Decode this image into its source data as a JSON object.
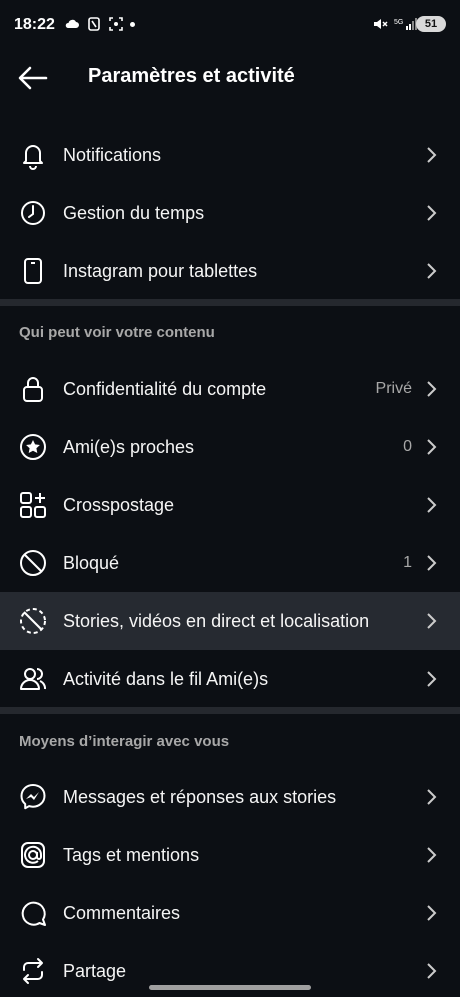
{
  "status_bar": {
    "time": "18:22",
    "battery": "51",
    "network": "5G"
  },
  "header": {
    "title": "Paramètres et activité"
  },
  "group1": [
    {
      "label": "Notifications",
      "value": "",
      "icon": "bell-icon"
    },
    {
      "label": "Gestion du temps",
      "value": "",
      "icon": "clock-icon"
    },
    {
      "label": "Instagram pour tablettes",
      "value": "",
      "icon": "tablet-icon"
    }
  ],
  "section_who": {
    "title": "Qui peut voir votre contenu",
    "items": [
      {
        "label": "Confidentialité du compte",
        "value": "Privé",
        "icon": "lock-icon"
      },
      {
        "label": "Ami(e)s proches",
        "value": "0",
        "icon": "star-circle-icon"
      },
      {
        "label": "Crosspostage",
        "value": "",
        "icon": "grid-plus-icon"
      },
      {
        "label": "Bloqué",
        "value": "1",
        "icon": "block-icon"
      },
      {
        "label": "Stories, vidéos en direct et localisation",
        "value": "",
        "icon": "story-off-icon"
      },
      {
        "label": "Activité dans le fil Ami(e)s",
        "value": "",
        "icon": "people-icon"
      }
    ]
  },
  "section_interact": {
    "title": "Moyens d’interagir avec vous",
    "items": [
      {
        "label": "Messages et réponses aux stories",
        "value": "",
        "icon": "messenger-icon"
      },
      {
        "label": "Tags et mentions",
        "value": "",
        "icon": "at-icon"
      },
      {
        "label": "Commentaires",
        "value": "",
        "icon": "comment-icon"
      },
      {
        "label": "Partage",
        "value": "",
        "icon": "repost-icon"
      }
    ]
  }
}
